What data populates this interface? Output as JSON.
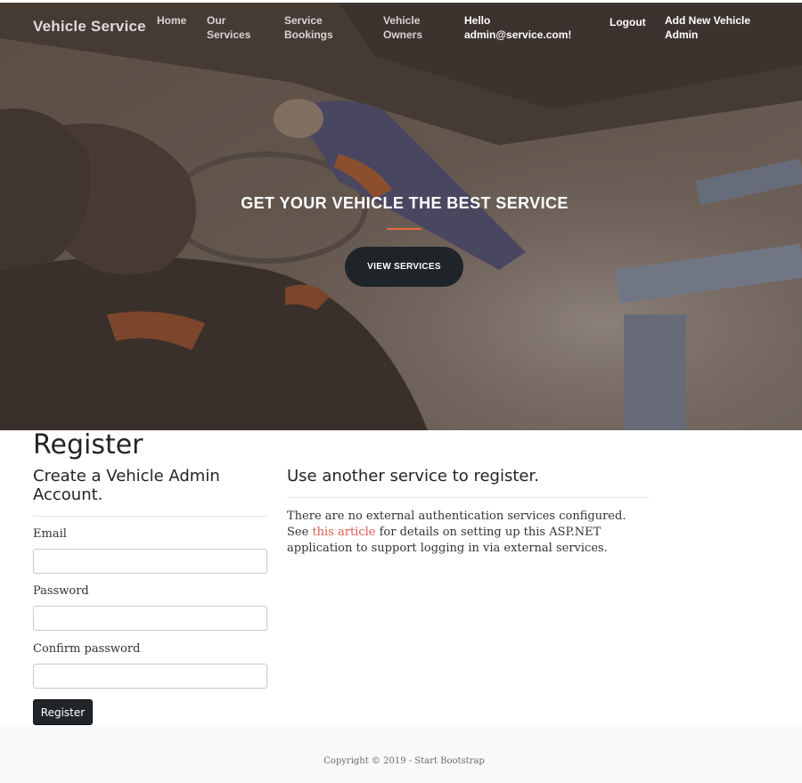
{
  "navbar": {
    "brand": "Vehicle Service",
    "links": [
      {
        "line1": "Home",
        "line2": ""
      },
      {
        "line1": "Our",
        "line2": "Services"
      },
      {
        "line1": "Service",
        "line2": "Bookings"
      },
      {
        "line1": "Vehicle",
        "line2": "Owners"
      },
      {
        "line1": "Hello",
        "line2": "admin@service.com!"
      },
      {
        "line1": "Logout",
        "line2": ""
      },
      {
        "line1": "Add New Vehicle",
        "line2": "Admin"
      }
    ]
  },
  "hero": {
    "title": "GET YOUR VEHICLE THE BEST SERVICE",
    "button_label": "VIEW SERVICES",
    "divider_color": "#e86a3c"
  },
  "register": {
    "page_title": "Register",
    "subtitle_line1": "Create a Vehicle Admin",
    "subtitle_line2": "Account.",
    "fields": {
      "email_label": "Email",
      "email_value": "",
      "password_label": "Password",
      "password_value": "",
      "confirm_label": "Confirm password",
      "confirm_value": ""
    },
    "submit_label": "Register"
  },
  "external": {
    "title": "Use another service to register.",
    "text_before": "There are no external authentication services configured. See ",
    "link_text": "this article",
    "text_after": " for details on setting up this ASP.NET application to support logging in via external services."
  },
  "footer": {
    "copyright": "Copyright © 2019 - Start Bootstrap"
  },
  "colors": {
    "accent": "#e86a3c",
    "dark_button": "#212529",
    "link": "#e05a4f"
  }
}
